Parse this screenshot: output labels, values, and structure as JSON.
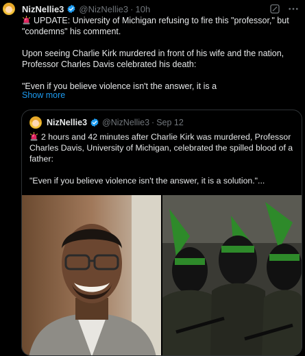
{
  "tweet": {
    "author_name": "NizNellie3",
    "author_handle": "@NizNellie3",
    "time": "10h",
    "line1": "UPDATE: University of Michigan refusing to fire this \"professor,\" but \"condemns\" his comment.",
    "line2": "Upon seeing Charlie Kirk murdered in front of his wife and the nation, Professor Charles Davis celebrated his death:",
    "line3": "\"Even if you believe violence isn't the answer, it is a",
    "show_more": "Show more"
  },
  "quote": {
    "author_name": "NizNellie3",
    "author_handle": "@NizNellie3",
    "time": "Sep 12",
    "line1": "2 hours and 42 minutes after Charlie Kirk was murdered, Professor Charles Davis, University of Michigan, celebrated the spilled blood of a father:",
    "line2": "\"Even if you believe violence isn't the answer, it is a solution.\"..."
  },
  "colors": {
    "background": "#000000",
    "text": "#e7e9ea",
    "muted": "#71767b",
    "link": "#1d9bf0",
    "verified": "#1d9bf0",
    "border": "#2f3336"
  },
  "icons": [
    "avatar",
    "verified-badge-icon",
    "siren-icon",
    "grok-icon",
    "more-options-icon"
  ]
}
